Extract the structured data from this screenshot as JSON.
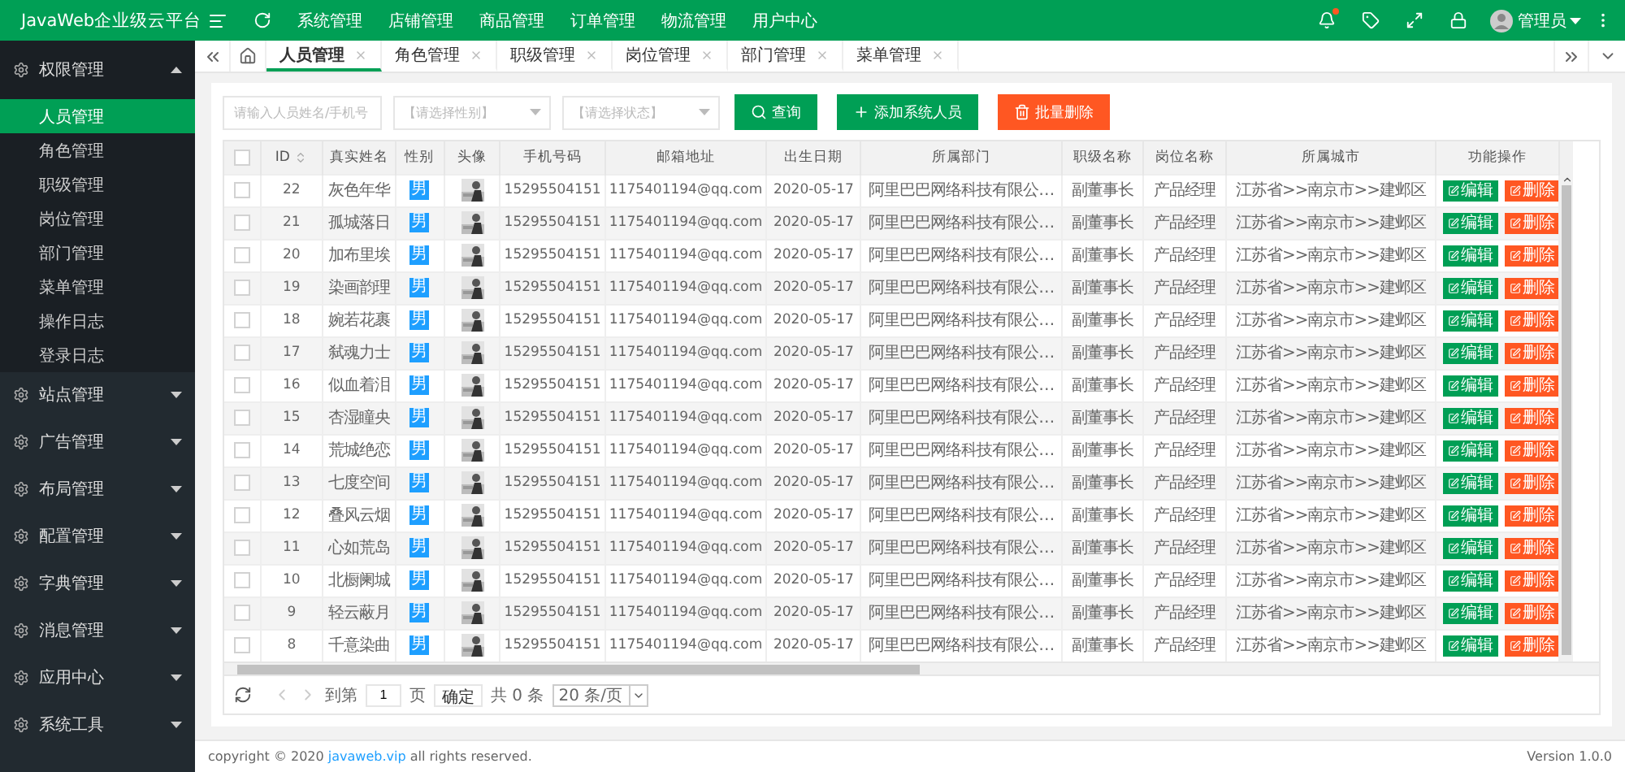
{
  "app": {
    "title": "JavaWeb企业级云平台"
  },
  "top_nav": [
    "系统管理",
    "店铺管理",
    "商品管理",
    "订单管理",
    "物流管理",
    "用户中心"
  ],
  "user": {
    "name": "管理员",
    "has_notification": true
  },
  "sidebar": {
    "items": [
      {
        "label": "权限管理",
        "expanded": true,
        "children": [
          {
            "label": "人员管理",
            "selected": true
          },
          {
            "label": "角色管理",
            "selected": false
          },
          {
            "label": "职级管理",
            "selected": false
          },
          {
            "label": "岗位管理",
            "selected": false
          },
          {
            "label": "部门管理",
            "selected": false
          },
          {
            "label": "菜单管理",
            "selected": false
          },
          {
            "label": "操作日志",
            "selected": false
          },
          {
            "label": "登录日志",
            "selected": false
          }
        ]
      },
      {
        "label": "站点管理",
        "expanded": false
      },
      {
        "label": "广告管理",
        "expanded": false
      },
      {
        "label": "布局管理",
        "expanded": false
      },
      {
        "label": "配置管理",
        "expanded": false
      },
      {
        "label": "字典管理",
        "expanded": false
      },
      {
        "label": "消息管理",
        "expanded": false
      },
      {
        "label": "应用中心",
        "expanded": false
      },
      {
        "label": "系统工具",
        "expanded": false
      }
    ]
  },
  "tabs": [
    {
      "label": "人员管理",
      "selected": true
    },
    {
      "label": "角色管理",
      "selected": false
    },
    {
      "label": "职级管理",
      "selected": false
    },
    {
      "label": "岗位管理",
      "selected": false
    },
    {
      "label": "部门管理",
      "selected": false
    },
    {
      "label": "菜单管理",
      "selected": false
    }
  ],
  "filters": {
    "search": {
      "placeholder": "请输入人员姓名/手机号"
    },
    "gender": {
      "placeholder": "【请选择性别】"
    },
    "status": {
      "placeholder": "【请选择状态】"
    }
  },
  "buttons": [
    {
      "kind": "search",
      "label": "查询"
    },
    {
      "kind": "add",
      "label": "添加系统人员"
    },
    {
      "kind": "delete",
      "label": "批量删除"
    }
  ],
  "table": {
    "all_checked": false,
    "columns": [
      "ID",
      "真实姓名",
      "性别",
      "头像",
      "手机号码",
      "邮箱地址",
      "出生日期",
      "所属部门",
      "职级名称",
      "岗位名称",
      "所属城市",
      "功能操作"
    ],
    "rows": [
      {
        "checked": false,
        "id": "22",
        "name": "灰色年华",
        "gender": "男",
        "phone": "15295504151",
        "email": "1175401194@qq.com",
        "birth": "2020-05-17",
        "dept": "阿里巴巴网络科技有限公…",
        "grade": "副董事长",
        "post": "产品经理",
        "city": "江苏省>>南京市>>建邺区",
        "actions": [
          "编辑",
          "删除"
        ]
      },
      {
        "checked": false,
        "id": "21",
        "name": "孤城落日",
        "gender": "男",
        "phone": "15295504151",
        "email": "1175401194@qq.com",
        "birth": "2020-05-17",
        "dept": "阿里巴巴网络科技有限公…",
        "grade": "副董事长",
        "post": "产品经理",
        "city": "江苏省>>南京市>>建邺区",
        "actions": [
          "编辑",
          "删除"
        ]
      },
      {
        "checked": false,
        "id": "20",
        "name": "加布里埃",
        "gender": "男",
        "phone": "15295504151",
        "email": "1175401194@qq.com",
        "birth": "2020-05-17",
        "dept": "阿里巴巴网络科技有限公…",
        "grade": "副董事长",
        "post": "产品经理",
        "city": "江苏省>>南京市>>建邺区",
        "actions": [
          "编辑",
          "删除"
        ]
      },
      {
        "checked": false,
        "id": "19",
        "name": "染画韵理",
        "gender": "男",
        "phone": "15295504151",
        "email": "1175401194@qq.com",
        "birth": "2020-05-17",
        "dept": "阿里巴巴网络科技有限公…",
        "grade": "副董事长",
        "post": "产品经理",
        "city": "江苏省>>南京市>>建邺区",
        "actions": [
          "编辑",
          "删除"
        ]
      },
      {
        "checked": false,
        "id": "18",
        "name": "婉若花裹",
        "gender": "男",
        "phone": "15295504151",
        "email": "1175401194@qq.com",
        "birth": "2020-05-17",
        "dept": "阿里巴巴网络科技有限公…",
        "grade": "副董事长",
        "post": "产品经理",
        "city": "江苏省>>南京市>>建邺区",
        "actions": [
          "编辑",
          "删除"
        ]
      },
      {
        "checked": false,
        "id": "17",
        "name": "弑魂力士",
        "gender": "男",
        "phone": "15295504151",
        "email": "1175401194@qq.com",
        "birth": "2020-05-17",
        "dept": "阿里巴巴网络科技有限公…",
        "grade": "副董事长",
        "post": "产品经理",
        "city": "江苏省>>南京市>>建邺区",
        "actions": [
          "编辑",
          "删除"
        ]
      },
      {
        "checked": false,
        "id": "16",
        "name": "似血着泪",
        "gender": "男",
        "phone": "15295504151",
        "email": "1175401194@qq.com",
        "birth": "2020-05-17",
        "dept": "阿里巴巴网络科技有限公…",
        "grade": "副董事长",
        "post": "产品经理",
        "city": "江苏省>>南京市>>建邺区",
        "actions": [
          "编辑",
          "删除"
        ]
      },
      {
        "checked": false,
        "id": "15",
        "name": "杏湿瞳央",
        "gender": "男",
        "phone": "15295504151",
        "email": "1175401194@qq.com",
        "birth": "2020-05-17",
        "dept": "阿里巴巴网络科技有限公…",
        "grade": "副董事长",
        "post": "产品经理",
        "city": "江苏省>>南京市>>建邺区",
        "actions": [
          "编辑",
          "删除"
        ]
      },
      {
        "checked": false,
        "id": "14",
        "name": "荒城绝恋",
        "gender": "男",
        "phone": "15295504151",
        "email": "1175401194@qq.com",
        "birth": "2020-05-17",
        "dept": "阿里巴巴网络科技有限公…",
        "grade": "副董事长",
        "post": "产品经理",
        "city": "江苏省>>南京市>>建邺区",
        "actions": [
          "编辑",
          "删除"
        ]
      },
      {
        "checked": false,
        "id": "13",
        "name": "七度空间",
        "gender": "男",
        "phone": "15295504151",
        "email": "1175401194@qq.com",
        "birth": "2020-05-17",
        "dept": "阿里巴巴网络科技有限公…",
        "grade": "副董事长",
        "post": "产品经理",
        "city": "江苏省>>南京市>>建邺区",
        "actions": [
          "编辑",
          "删除"
        ]
      },
      {
        "checked": false,
        "id": "12",
        "name": "叠风云烟",
        "gender": "男",
        "phone": "15295504151",
        "email": "1175401194@qq.com",
        "birth": "2020-05-17",
        "dept": "阿里巴巴网络科技有限公…",
        "grade": "副董事长",
        "post": "产品经理",
        "city": "江苏省>>南京市>>建邺区",
        "actions": [
          "编辑",
          "删除"
        ]
      },
      {
        "checked": false,
        "id": "11",
        "name": "心如荒岛",
        "gender": "男",
        "phone": "15295504151",
        "email": "1175401194@qq.com",
        "birth": "2020-05-17",
        "dept": "阿里巴巴网络科技有限公…",
        "grade": "副董事长",
        "post": "产品经理",
        "city": "江苏省>>南京市>>建邺区",
        "actions": [
          "编辑",
          "删除"
        ]
      },
      {
        "checked": false,
        "id": "10",
        "name": "北橱阑城",
        "gender": "男",
        "phone": "15295504151",
        "email": "1175401194@qq.com",
        "birth": "2020-05-17",
        "dept": "阿里巴巴网络科技有限公…",
        "grade": "副董事长",
        "post": "产品经理",
        "city": "江苏省>>南京市>>建邺区",
        "actions": [
          "编辑",
          "删除"
        ]
      },
      {
        "checked": false,
        "id": "9",
        "name": "轻云蔽月",
        "gender": "男",
        "phone": "15295504151",
        "email": "1175401194@qq.com",
        "birth": "2020-05-17",
        "dept": "阿里巴巴网络科技有限公…",
        "grade": "副董事长",
        "post": "产品经理",
        "city": "江苏省>>南京市>>建邺区",
        "actions": [
          "编辑",
          "删除"
        ]
      },
      {
        "checked": false,
        "id": "8",
        "name": "千意染曲",
        "gender": "男",
        "phone": "15295504151",
        "email": "1175401194@qq.com",
        "birth": "2020-05-17",
        "dept": "阿里巴巴网络科技有限公…",
        "grade": "副董事长",
        "post": "产品经理",
        "city": "江苏省>>南京市>>建邺区",
        "actions": [
          "编辑",
          "删除"
        ]
      }
    ]
  },
  "pagination": {
    "goto_label": "到第",
    "page": "1",
    "page_unit": "页",
    "confirm": "确定",
    "total": "共 0 条",
    "page_size": "20 条/页"
  },
  "footer": {
    "copyright_before": "copyright © 2020 ",
    "link": "javaweb.vip",
    "copyright_after": " all rights reserved.",
    "version": "Version 1.0.0"
  }
}
